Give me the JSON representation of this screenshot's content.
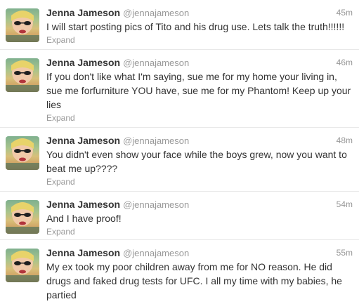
{
  "tweets": [
    {
      "fullname": "Jenna Jameson",
      "username": "@jennajameson",
      "time": "45m",
      "text": "I will start posting pics of Tito and his drug use. Lets talk the truth!!!!!!",
      "expand_label": "Expand"
    },
    {
      "fullname": "Jenna Jameson",
      "username": "@jennajameson",
      "time": "46m",
      "text": "If you don't like what I'm saying, sue me for my home your living in, sue me forfurniture YOU have, sue me for my Phantom! Keep up your lies",
      "expand_label": "Expand"
    },
    {
      "fullname": "Jenna Jameson",
      "username": "@jennajameson",
      "time": "48m",
      "text": "You didn't even show your face while the boys grew, now you want to beat me up????",
      "expand_label": "Expand"
    },
    {
      "fullname": "Jenna Jameson",
      "username": "@jennajameson",
      "time": "54m",
      "text": "And I have proof!",
      "expand_label": "Expand"
    },
    {
      "fullname": "Jenna Jameson",
      "username": "@jennajameson",
      "time": "55m",
      "text": "My ex took my poor children away from me for NO reason. He did drugs and faked drug tests for UFC. I all my time with my babies, he partied",
      "expand_label": ""
    }
  ]
}
